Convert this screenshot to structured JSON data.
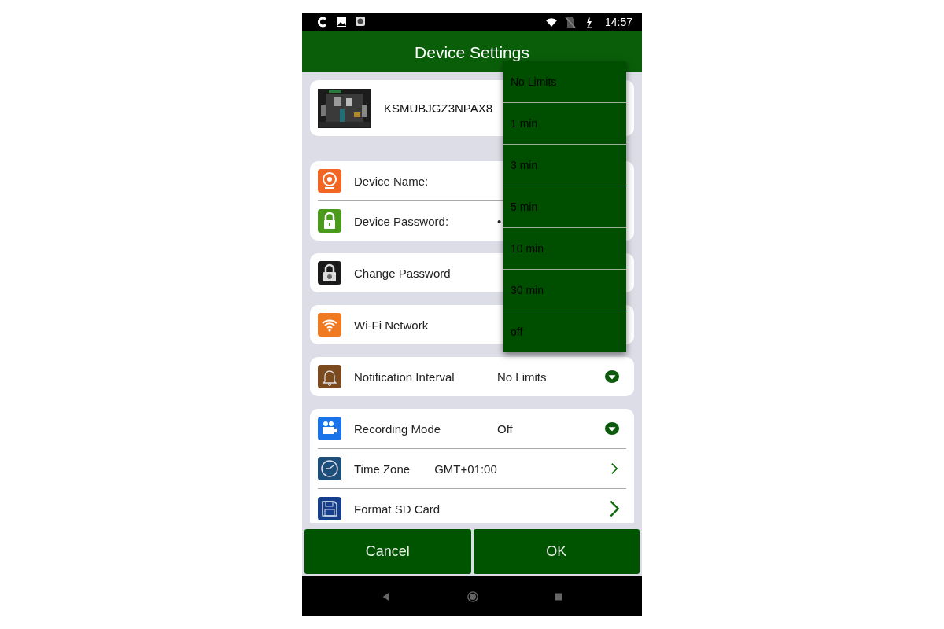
{
  "status_bar": {
    "time": "14:57"
  },
  "header": {
    "title": "Device Settings"
  },
  "device": {
    "id": "KSMUBJGZ3NPAX8"
  },
  "groups": [
    {
      "rows": [
        {
          "kind": "field",
          "label": "Device Name:"
        },
        {
          "kind": "field",
          "label": "Device Password:",
          "value": "•"
        }
      ]
    },
    {
      "rows": [
        {
          "kind": "action",
          "label": "Change Password"
        }
      ]
    },
    {
      "rows": [
        {
          "kind": "field",
          "label": "Wi-Fi Network"
        }
      ]
    },
    {
      "rows": [
        {
          "kind": "select",
          "label": "Notification Interval",
          "value": "No Limits"
        }
      ]
    },
    {
      "rows": [
        {
          "kind": "select",
          "label": "Recording Mode",
          "value": "Off"
        },
        {
          "kind": "link",
          "label": "Time Zone",
          "value": "GMT+01:00"
        },
        {
          "kind": "link",
          "label": "Format SD Card"
        }
      ]
    }
  ],
  "menu": {
    "items": [
      "No Limits",
      "1 min",
      "3 min",
      "5 min",
      "10 min",
      "30 min",
      "off"
    ]
  },
  "buttons": [
    {
      "label": "Cancel"
    },
    {
      "label": "OK"
    }
  ]
}
